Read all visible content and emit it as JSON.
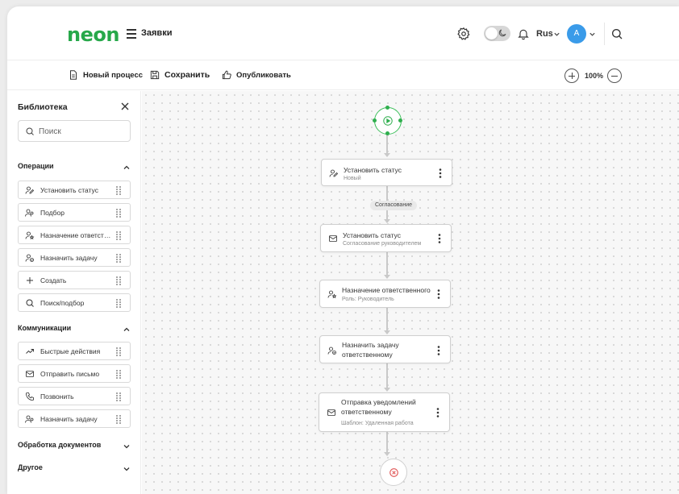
{
  "header": {
    "logo": "neon",
    "title": "Заявки",
    "language": "Rus",
    "avatar_initial": "A"
  },
  "toolbar": {
    "new_process": "Новый процесс",
    "save": "Сохранить",
    "publish": "Опубликовать",
    "zoom": "100%"
  },
  "sidebar": {
    "title": "Библиотека",
    "search_placeholder": "Поиск",
    "sections": [
      {
        "title": "Операции",
        "expanded": true,
        "items": [
          {
            "label": "Установить статус",
            "icon": "user-edit-icon"
          },
          {
            "label": "Подбор",
            "icon": "users-icon"
          },
          {
            "label": "Назначение ответственного",
            "icon": "user-star-icon"
          },
          {
            "label": "Назначить задачу",
            "icon": "user-check-icon"
          },
          {
            "label": "Создать",
            "icon": "plus-icon"
          },
          {
            "label": "Поиск/подбор",
            "icon": "search-icon"
          }
        ]
      },
      {
        "title": "Коммуникации",
        "expanded": true,
        "items": [
          {
            "label": "Быстрые действия",
            "icon": "trend-icon"
          },
          {
            "label": "Отправить письмо",
            "icon": "mail-icon"
          },
          {
            "label": "Позвонить",
            "icon": "phone-icon"
          },
          {
            "label": "Назначить задачу",
            "icon": "users-icon"
          }
        ]
      },
      {
        "title": "Обработка документов",
        "expanded": false,
        "items": []
      },
      {
        "title": "Другое",
        "expanded": false,
        "items": []
      }
    ]
  },
  "canvas": {
    "edge_label": "Согласование",
    "nodes": [
      {
        "title": "Установить статус",
        "subtitle": "Новый",
        "icon": "user-edit-icon"
      },
      {
        "title": "Установить статус",
        "subtitle": "Согласование руководителем",
        "icon": "mail-icon"
      },
      {
        "title": "Назначение ответственного",
        "subtitle": "Роль: Руководитель",
        "icon": "user-star-icon"
      },
      {
        "title": "Назначить задачу ответственному",
        "subtitle": "",
        "icon": "user-check-icon"
      },
      {
        "title": "Отправка уведомлений ответственному",
        "subtitle": "Шаблон: Удаленная работа",
        "icon": "mail-icon"
      }
    ]
  },
  "colors": {
    "brand": "#27a84a",
    "avatar": "#3a9be9",
    "end_icon": "#e05555"
  }
}
